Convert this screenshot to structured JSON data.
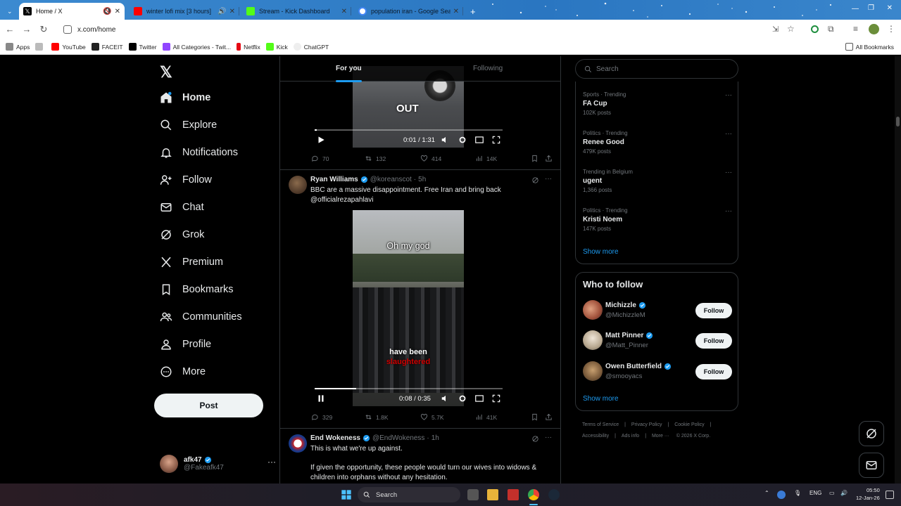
{
  "browser": {
    "tabs": [
      {
        "title": "Home / X",
        "fav_color": "#000000"
      },
      {
        "title": "winter lofi mix [3 hours]",
        "fav_color": "#ff0000"
      },
      {
        "title": "Stream - Kick Dashboard",
        "fav_color": "#53fc18"
      },
      {
        "title": "population iran - Google Searc",
        "fav_color": "#4285f4"
      }
    ],
    "address": "x.com/home",
    "bookmarks": [
      {
        "label": "Apps"
      },
      {
        "label": "YouTube"
      },
      {
        "label": "FACEIT"
      },
      {
        "label": "Twitter"
      },
      {
        "label": "All Categories - Twit..."
      },
      {
        "label": "Netflix"
      },
      {
        "label": "Kick"
      },
      {
        "label": "ChatGPT"
      }
    ],
    "all_bookmarks": "All Bookmarks"
  },
  "nav": {
    "items": [
      {
        "label": "Home",
        "icon": "home-icon"
      },
      {
        "label": "Explore",
        "icon": "search-icon"
      },
      {
        "label": "Notifications",
        "icon": "bell-icon"
      },
      {
        "label": "Follow",
        "icon": "person-add-icon"
      },
      {
        "label": "Chat",
        "icon": "mail-icon"
      },
      {
        "label": "Grok",
        "icon": "grok-icon"
      },
      {
        "label": "Premium",
        "icon": "x-logo-icon"
      },
      {
        "label": "Bookmarks",
        "icon": "bookmark-icon"
      },
      {
        "label": "Communities",
        "icon": "communities-icon"
      },
      {
        "label": "Profile",
        "icon": "person-icon"
      },
      {
        "label": "More",
        "icon": "more-circle-icon"
      }
    ],
    "post_label": "Post",
    "account": {
      "name": "afk47",
      "handle": "@Fakeafk47"
    }
  },
  "feed": {
    "tabs": [
      "For you",
      "Following"
    ],
    "tweet0": {
      "video_overlay": "OUT",
      "time": "0:01 / 1:31",
      "progress": 0.01,
      "replies": "70",
      "reposts": "132",
      "likes": "414",
      "views": "14K"
    },
    "tweet1": {
      "name": "Ryan Williams",
      "handle": "@koreanscot",
      "age": "5h",
      "text": "BBC are a massive disappointment. Free Iran and bring back @officialrezapahlavi",
      "caption_top": "Oh my god",
      "caption_bottom1": "have been",
      "caption_bottom2": "slaughtered",
      "time": "0:08 / 0:35",
      "progress": 0.22,
      "replies": "329",
      "reposts": "1.8K",
      "likes": "5.7K",
      "views": "41K"
    },
    "tweet2": {
      "name": "End Wokeness",
      "handle": "@EndWokeness",
      "age": "1h",
      "line1": "This is what we're up against.",
      "line2": "If given the opportunity, these people would turn our wives into widows & children into orphans without any hesitation."
    }
  },
  "sidebar": {
    "search_placeholder": "Search",
    "trends": [
      {
        "context": "Sports · Trending",
        "name": "FA Cup",
        "posts": "102K posts"
      },
      {
        "context": "Politics · Trending",
        "name": "Renee Good",
        "posts": "479K posts"
      },
      {
        "context": "Trending in Belgium",
        "name": "ugent",
        "posts": "1,366 posts"
      },
      {
        "context": "Politics · Trending",
        "name": "Kristi Noem",
        "posts": "147K posts"
      }
    ],
    "show_more": "Show more",
    "who_to_follow": {
      "title": "Who to follow",
      "accounts": [
        {
          "name": "Michizzle",
          "handle": "@MichizzleM"
        },
        {
          "name": "Matt Pinner",
          "handle": "@Matt_Pinner"
        },
        {
          "name": "Owen Butterfield",
          "handle": "@smooyacs"
        }
      ],
      "follow_label": "Follow",
      "show_more": "Show more"
    },
    "footer": [
      "Terms of Service",
      "Privacy Policy",
      "Cookie Policy",
      "Accessibility",
      "Ads info",
      "More ···",
      "© 2026 X Corp."
    ]
  },
  "taskbar": {
    "search": "Search",
    "lang": "ENG",
    "time": "05:50",
    "date": "12-Jan-26"
  },
  "colors": {
    "accent": "#1d9bf0",
    "verified": "#1d9bf0"
  }
}
